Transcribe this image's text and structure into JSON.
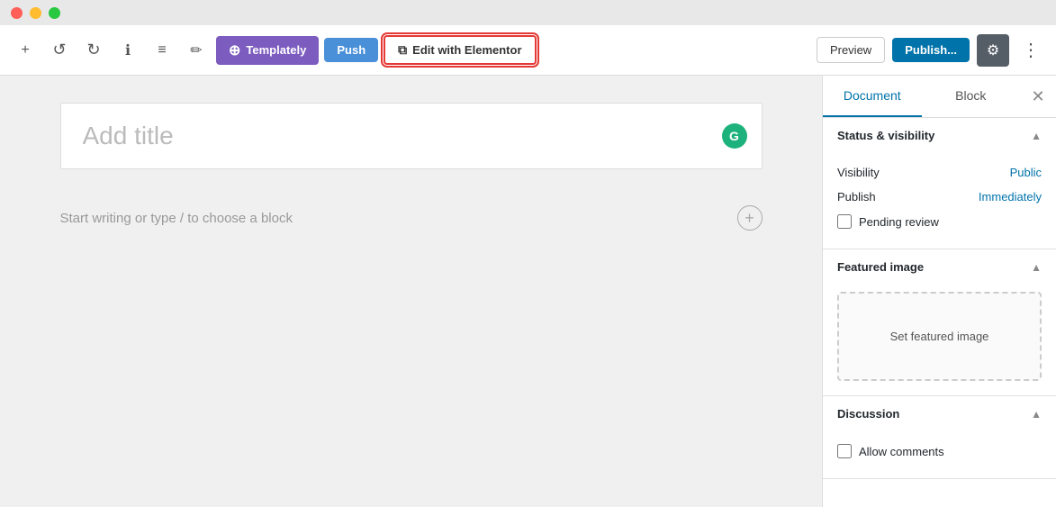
{
  "titleBar": {
    "trafficLights": [
      "red",
      "yellow",
      "green"
    ]
  },
  "toolbar": {
    "buttons": {
      "add": "+",
      "undo": "↺",
      "redo": "↻",
      "info": "ℹ",
      "list": "≡",
      "pen": "✏"
    },
    "templately": "Templately",
    "push": "Push",
    "editWithElementor": "Edit with Elementor",
    "preview": "Preview",
    "publish": "Publish...",
    "settings": "⚙",
    "more": "⋮"
  },
  "editor": {
    "titlePlaceholder": "Add title",
    "contentPlaceholder": "Start writing or type / to choose a block",
    "grammarlyIcon": "G"
  },
  "sidebar": {
    "tabs": {
      "document": "Document",
      "block": "Block"
    },
    "closeIcon": "✕",
    "sections": {
      "statusVisibility": {
        "title": "Status & visibility",
        "visibility": {
          "label": "Visibility",
          "value": "Public"
        },
        "publish": {
          "label": "Publish",
          "value": "Immediately"
        },
        "pendingReview": {
          "label": "Pending review",
          "checked": false
        }
      },
      "featuredImage": {
        "title": "Featured image",
        "setImageLabel": "Set featured image"
      },
      "discussion": {
        "title": "Discussion",
        "allowComments": {
          "label": "Allow comments",
          "checked": false
        }
      }
    }
  }
}
